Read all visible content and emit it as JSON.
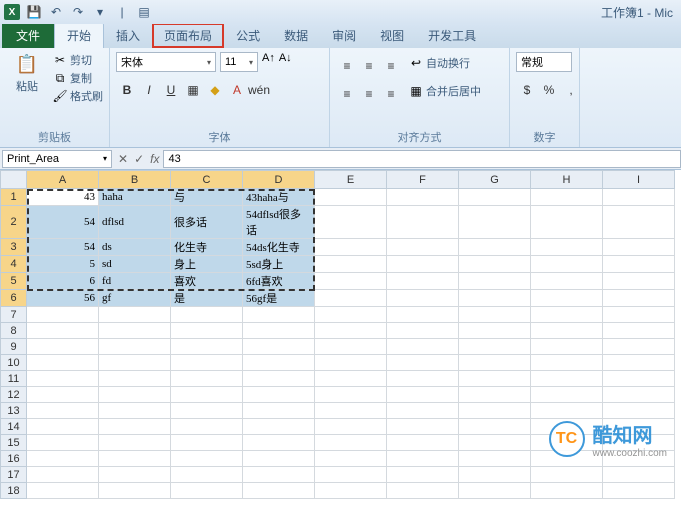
{
  "title": "工作簿1 - Mic",
  "tabs": {
    "file": "文件",
    "home": "开始",
    "insert": "插入",
    "pagelayout": "页面布局",
    "formulas": "公式",
    "data": "数据",
    "review": "审阅",
    "view": "视图",
    "developer": "开发工具"
  },
  "clipboard": {
    "paste": "粘贴",
    "cut": "剪切",
    "copy": "复制",
    "brush": "格式刷",
    "label": "剪贴板"
  },
  "font": {
    "name": "宋体",
    "size": "11",
    "label": "字体"
  },
  "align": {
    "wrap": "自动换行",
    "merge": "合并后居中",
    "label": "对齐方式"
  },
  "number": {
    "format": "常规",
    "label": "数字"
  },
  "namebox": "Print_Area",
  "formula": "43",
  "cols": [
    "A",
    "B",
    "C",
    "D",
    "E",
    "F",
    "G",
    "H",
    "I"
  ],
  "selcols": 4,
  "rows": 18,
  "selrows": 6,
  "data_rows": [
    {
      "a": "43",
      "b": "haha",
      "c": "与",
      "d": "43haha与"
    },
    {
      "a": "54",
      "b": "dflsd",
      "c": "很多话",
      "d": "54dflsd很多话"
    },
    {
      "a": "54",
      "b": "ds",
      "c": "化生寺",
      "d": "54ds化生寺"
    },
    {
      "a": "5",
      "b": "sd",
      "c": "身上",
      "d": "5sd身上"
    },
    {
      "a": "6",
      "b": "fd",
      "c": "喜欢",
      "d": "6fd喜欢"
    },
    {
      "a": "56",
      "b": "gf",
      "c": "是",
      "d": "56gf是"
    }
  ],
  "watermark": {
    "logo": "TC",
    "name": "酷知网",
    "url": "www.coozhi.com"
  }
}
